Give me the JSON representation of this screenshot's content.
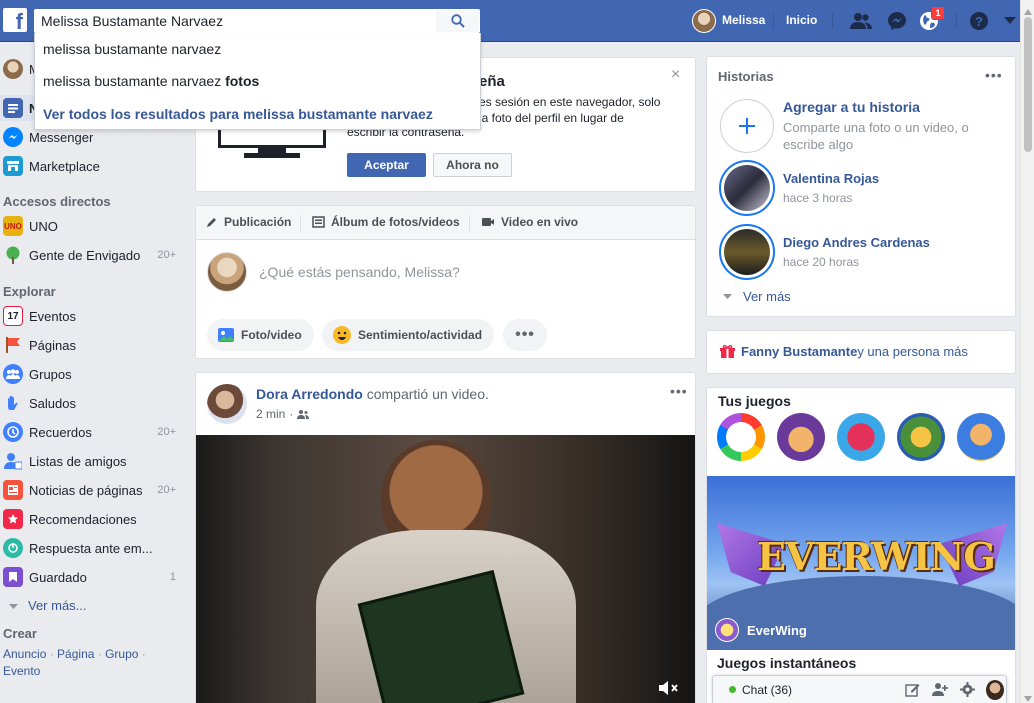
{
  "topbar": {
    "search_value": "Melissa Bustamante Narvaez",
    "user_name": "Melissa",
    "home_label": "Inicio",
    "notification_count": "1",
    "brand_color": "#4267b2"
  },
  "search_dropdown": {
    "suggestion_1": "melissa bustamante narvaez",
    "suggestion_2_prefix": "melissa bustamante narvaez ",
    "suggestion_2_bold": "fotos",
    "see_all": "Ver todos los resultados para melissa bustamante narvaez"
  },
  "sidebar": {
    "profile_label": "M",
    "newsfeed_label": "N",
    "items_top": [
      {
        "label": "Messenger",
        "icon": "messenger-icon"
      },
      {
        "label": "Marketplace",
        "icon": "marketplace-icon"
      }
    ],
    "shortcuts_header": "Accesos directos",
    "shortcuts": [
      {
        "label": "UNO",
        "count": "",
        "icon": "uno-icon"
      },
      {
        "label": "Gente de Envigado",
        "count": "20+",
        "icon": "group-tree-icon"
      }
    ],
    "explore_header": "Explorar",
    "explore": [
      {
        "label": "Eventos",
        "count": "",
        "icon": "calendar-icon"
      },
      {
        "label": "Páginas",
        "count": "",
        "icon": "flag-icon"
      },
      {
        "label": "Grupos",
        "count": "",
        "icon": "groups-icon"
      },
      {
        "label": "Saludos",
        "count": "",
        "icon": "wave-icon"
      },
      {
        "label": "Recuerdos",
        "count": "20+",
        "icon": "memories-icon"
      },
      {
        "label": "Listas de amigos",
        "count": "",
        "icon": "friends-list-icon"
      },
      {
        "label": "Noticias de páginas",
        "count": "20+",
        "icon": "page-feed-icon"
      },
      {
        "label": "Recomendaciones",
        "count": "",
        "icon": "recommendations-icon"
      },
      {
        "label": "Respuesta ante em...",
        "count": "",
        "icon": "crisis-response-icon"
      },
      {
        "label": "Guardado",
        "count": "1",
        "icon": "saved-icon"
      }
    ],
    "see_more": "Ver más...",
    "create_header": "Crear",
    "create_links": [
      "Anuncio",
      "Página",
      "Grupo",
      "Evento"
    ]
  },
  "password_card": {
    "title_visible": "eña",
    "line1": "es sesión en este navegador, solo",
    "line2": "la foto del perfil en lugar de",
    "line3": "escribir la contraseña.",
    "accept": "Aceptar",
    "decline": "Ahora no"
  },
  "composer": {
    "tab_post": "Publicación",
    "tab_album": "Álbum de fotos/videos",
    "tab_live": "Video en vivo",
    "placeholder": "¿Qué estás pensando, Melissa?",
    "btn_photo": "Foto/video",
    "btn_feeling": "Sentimiento/actividad"
  },
  "post": {
    "author": "Dora Arredondo",
    "action": " compartió un video.",
    "time": "2 min"
  },
  "stories": {
    "header": "Historias",
    "add_title": "Agregar a tu historia",
    "add_sub1": "Comparte una foto o un video, o",
    "add_sub2": "escribe algo",
    "items": [
      {
        "name": "Valentina Rojas",
        "time": "hace 3 horas"
      },
      {
        "name": "Diego Andres Cardenas",
        "time": "hace 20 horas"
      }
    ],
    "see_more": "Ver más"
  },
  "birthday": {
    "name": "Fanny Bustamante",
    "rest": " y una persona más"
  },
  "games": {
    "header": "Tus juegos",
    "featured": "EverWing",
    "featured_title_art": "EVERWING",
    "instant_header": "Juegos instantáneos"
  },
  "chat": {
    "label": "Chat (36)",
    "online_color": "#42b72a"
  }
}
